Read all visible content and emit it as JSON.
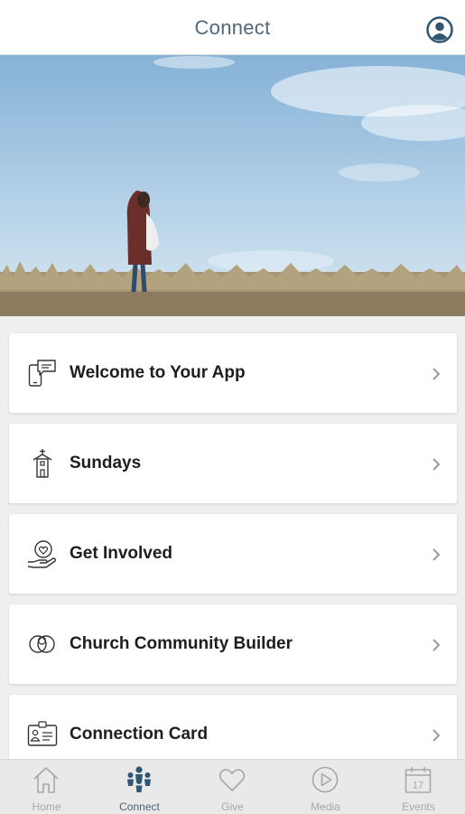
{
  "header": {
    "title": "Connect"
  },
  "menu": [
    {
      "label": "Welcome to Your App",
      "icon": "chat-phone-icon"
    },
    {
      "label": "Sundays",
      "icon": "church-icon"
    },
    {
      "label": "Get Involved",
      "icon": "hand-heart-icon"
    },
    {
      "label": "Church Community Builder",
      "icon": "rings-icon"
    },
    {
      "label": "Connection Card",
      "icon": "id-card-icon"
    }
  ],
  "tabs": [
    {
      "label": "Home",
      "icon": "home-icon",
      "active": false
    },
    {
      "label": "Connect",
      "icon": "people-icon",
      "active": true
    },
    {
      "label": "Give",
      "icon": "heart-icon",
      "active": false
    },
    {
      "label": "Media",
      "icon": "play-icon",
      "active": false
    },
    {
      "label": "Events",
      "icon": "calendar-icon",
      "active": false
    }
  ],
  "calendar_day": "17",
  "colors": {
    "accent": "#2f5672",
    "inactive": "#a7a7a7"
  }
}
